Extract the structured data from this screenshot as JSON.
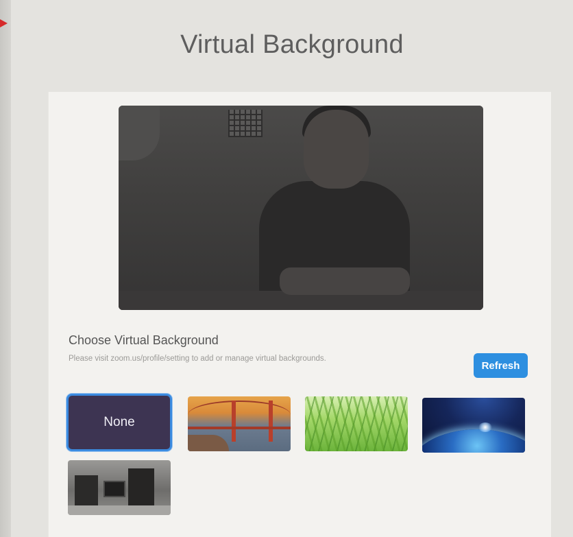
{
  "window": {
    "title": "Virtual Background"
  },
  "preview": {
    "label": "camera-preview"
  },
  "section": {
    "title": "Choose Virtual Background",
    "description": "Please visit zoom.us/profile/setting to add or manage virtual backgrounds.",
    "refresh_label": "Refresh"
  },
  "backgrounds": [
    {
      "id": "none",
      "label": "None",
      "selected": true
    },
    {
      "id": "golden-gate-bridge",
      "label": "",
      "selected": false
    },
    {
      "id": "grass",
      "label": "",
      "selected": false
    },
    {
      "id": "earth-from-space",
      "label": "",
      "selected": false
    },
    {
      "id": "room",
      "label": "",
      "selected": false
    }
  ],
  "colors": {
    "accent": "#2d8fe0",
    "selected_border": "#3b8be0",
    "none_tile": "#3d3452",
    "cursor_arrow": "#d62a2a"
  }
}
